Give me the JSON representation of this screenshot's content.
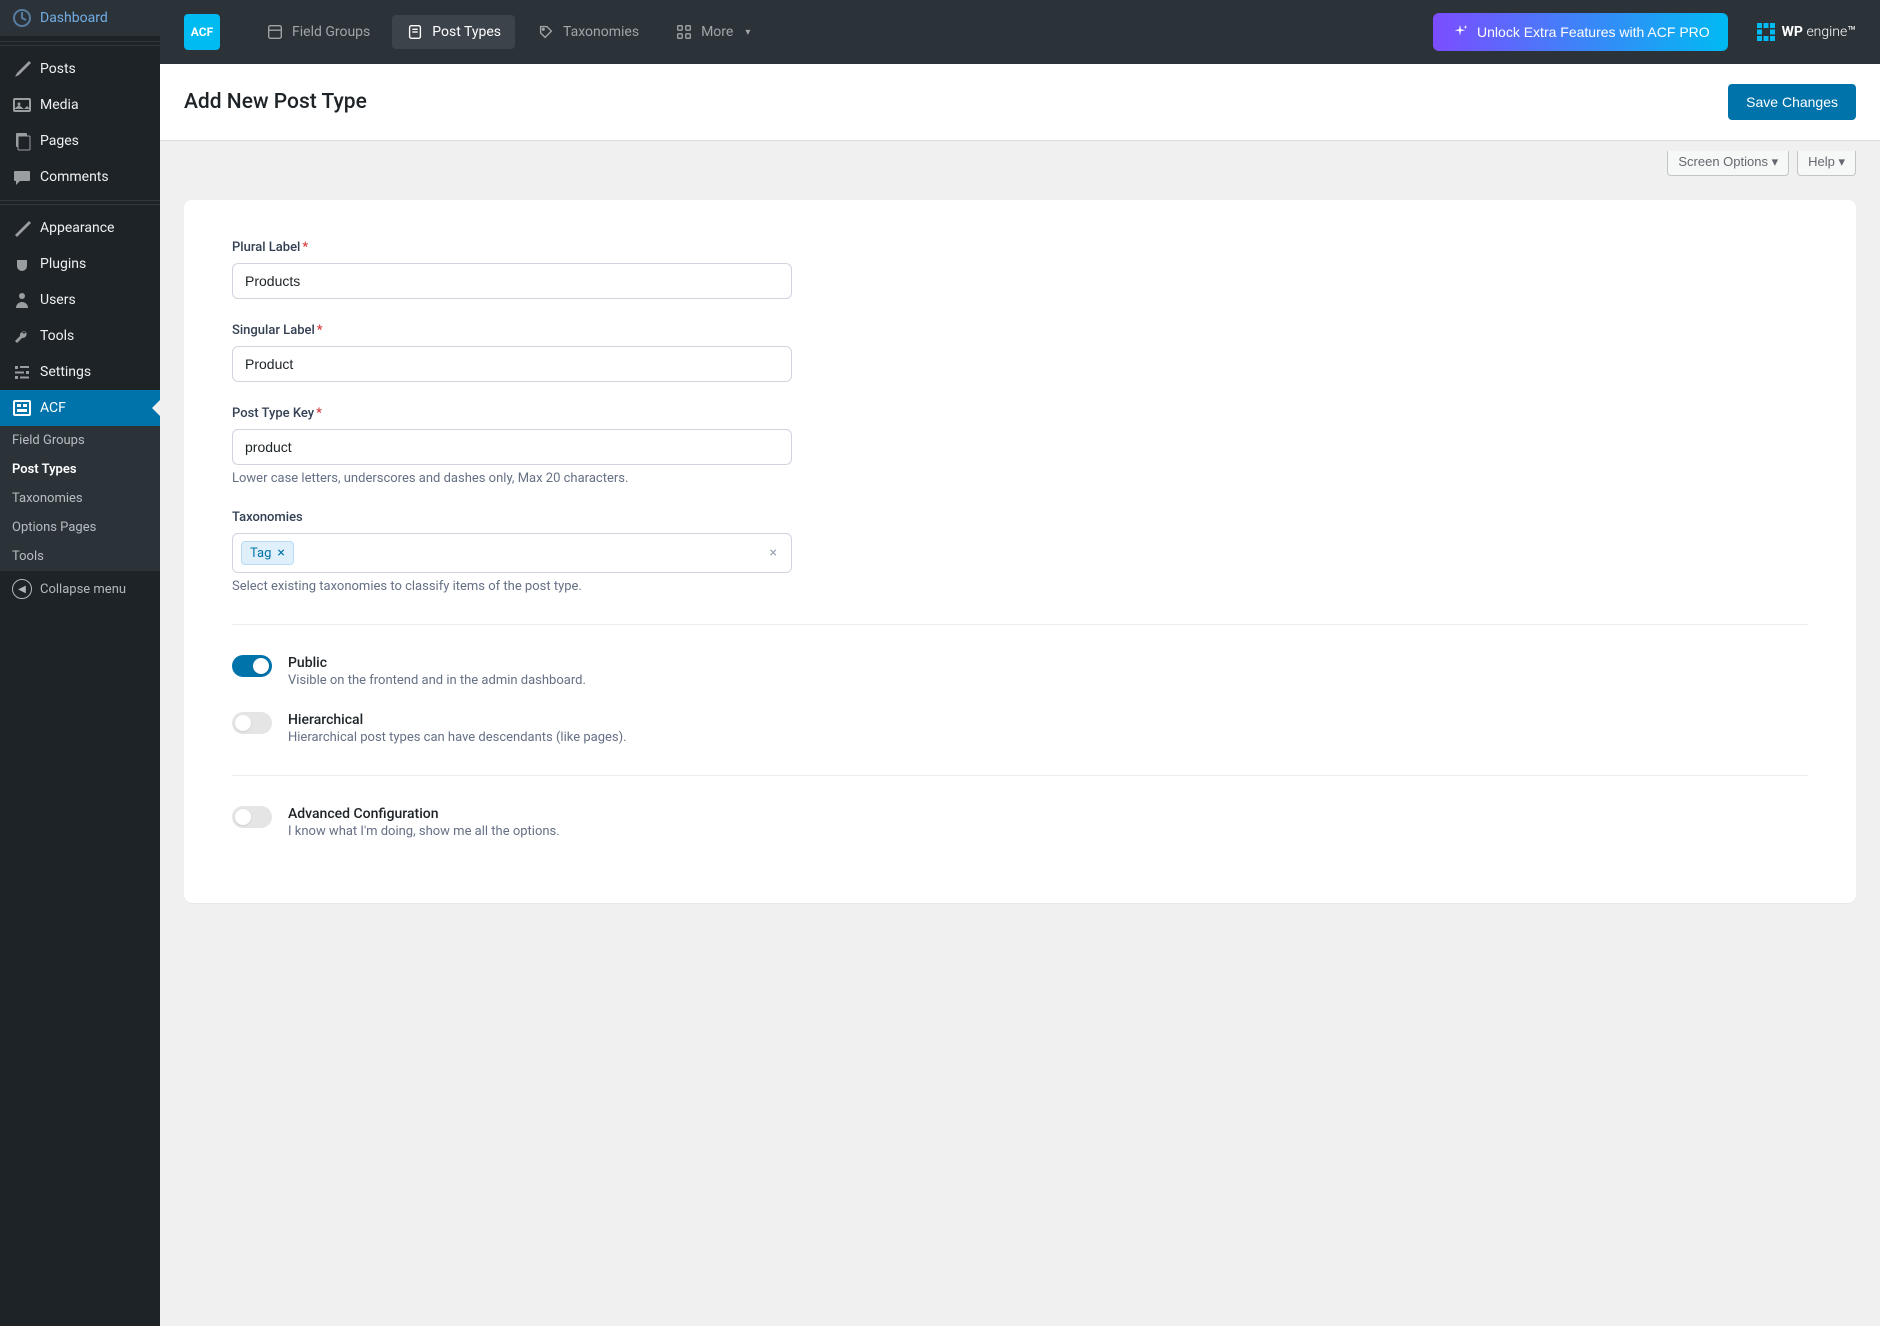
{
  "sidebar": {
    "items": [
      {
        "label": "Dashboard",
        "icon": "dashboard"
      },
      {
        "label": "Posts",
        "icon": "posts"
      },
      {
        "label": "Media",
        "icon": "media"
      },
      {
        "label": "Pages",
        "icon": "pages"
      },
      {
        "label": "Comments",
        "icon": "comments"
      },
      {
        "label": "Appearance",
        "icon": "appearance"
      },
      {
        "label": "Plugins",
        "icon": "plugins"
      },
      {
        "label": "Users",
        "icon": "users"
      },
      {
        "label": "Tools",
        "icon": "tools"
      },
      {
        "label": "Settings",
        "icon": "settings"
      },
      {
        "label": "ACF",
        "icon": "acf",
        "active": true
      }
    ],
    "submenu": [
      {
        "label": "Field Groups"
      },
      {
        "label": "Post Types",
        "active": true
      },
      {
        "label": "Taxonomies"
      },
      {
        "label": "Options Pages"
      },
      {
        "label": "Tools"
      }
    ],
    "collapse": "Collapse menu"
  },
  "topbar": {
    "logo": "ACF",
    "nav": [
      {
        "label": "Field Groups"
      },
      {
        "label": "Post Types",
        "active": true
      },
      {
        "label": "Taxonomies"
      },
      {
        "label": "More",
        "chevron": true
      }
    ],
    "pro": "Unlock Extra Features with ACF PRO",
    "wpengine_prefix": "WP",
    "wpengine_suffix": "engine"
  },
  "header": {
    "title": "Add New Post Type",
    "save": "Save Changes",
    "screen_options": "Screen Options",
    "help": "Help"
  },
  "form": {
    "plural": {
      "label": "Plural Label",
      "value": "Products"
    },
    "singular": {
      "label": "Singular Label",
      "value": "Product"
    },
    "key": {
      "label": "Post Type Key",
      "value": "product",
      "help": "Lower case letters, underscores and dashes only, Max 20 characters."
    },
    "taxonomies": {
      "label": "Taxonomies",
      "chip": "Tag",
      "help": "Select existing taxonomies to classify items of the post type."
    },
    "public": {
      "title": "Public",
      "desc": "Visible on the frontend and in the admin dashboard."
    },
    "hierarchical": {
      "title": "Hierarchical",
      "desc": "Hierarchical post types can have descendants (like pages)."
    },
    "advanced": {
      "title": "Advanced Configuration",
      "desc": "I know what I'm doing, show me all the options."
    }
  }
}
